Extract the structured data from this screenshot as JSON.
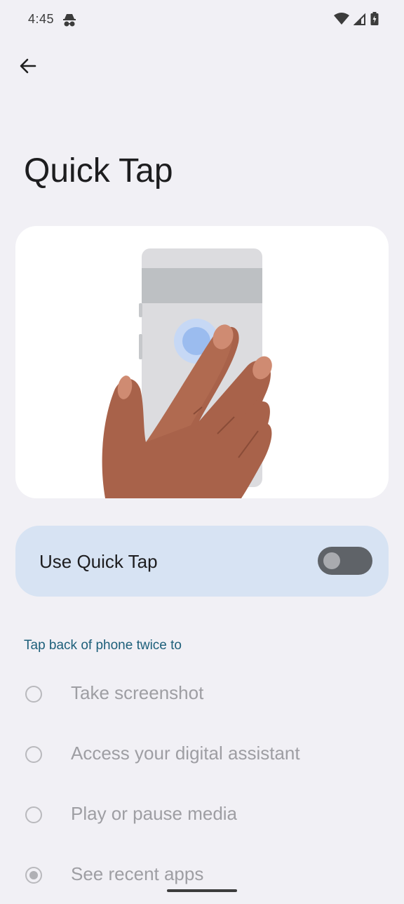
{
  "status_bar": {
    "time": "4:45",
    "left_icon": "incognito-icon",
    "right_icons": [
      "wifi-icon",
      "signal-icon",
      "battery-icon"
    ]
  },
  "header": {
    "back_icon": "arrow-back-icon"
  },
  "page": {
    "title": "Quick Tap"
  },
  "illustration": {
    "icon": "hand-tapping-phone-illustration"
  },
  "main_toggle": {
    "label": "Use Quick Tap",
    "state": "off"
  },
  "options": {
    "section_title": "Tap back of phone twice to",
    "items": [
      {
        "label": "Take screenshot",
        "selected": false
      },
      {
        "label": "Access your digital assistant",
        "selected": false
      },
      {
        "label": "Play or pause media",
        "selected": false
      },
      {
        "label": "See recent apps",
        "selected": true
      }
    ]
  },
  "colors": {
    "background": "#f1f0f5",
    "toggle_card": "#d7e3f3",
    "section_header": "#1d5f7a",
    "skin": "#a8624a"
  }
}
